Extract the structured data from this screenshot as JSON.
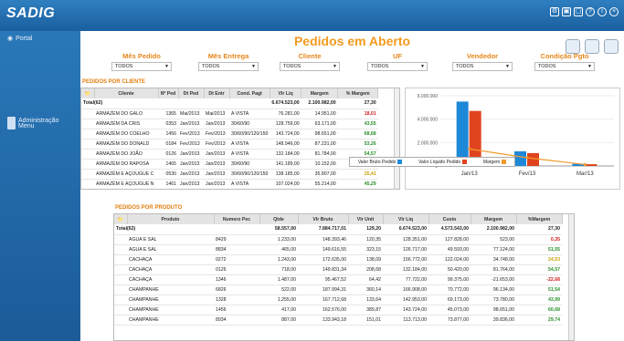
{
  "app": {
    "logo": "SADIG",
    "portal": "Portal"
  },
  "sidebar": [
    {
      "label": "Administração",
      "top": 92
    },
    {
      "label": "Menu",
      "top": 100
    }
  ],
  "page": {
    "title": "Pedidos em Aberto",
    "section1": "PEDIDOS POR CLIENTE",
    "section2": "PEDIDOS POR PRODUTO"
  },
  "filters": [
    {
      "label": "Mês Pedido",
      "value": "TODOS"
    },
    {
      "label": "Mês Entrega",
      "value": "TODOS"
    },
    {
      "label": "Cliente",
      "value": "TODOS"
    },
    {
      "label": "UF",
      "value": "TODOS"
    },
    {
      "label": "Vendedor",
      "value": "TODOS"
    },
    {
      "label": "Condição Pgto",
      "value": "TODOS"
    }
  ],
  "clients": {
    "headers": [
      "Cliente",
      "Nº Ped",
      "Dt Ped",
      "Dt Entr",
      "Cond. Pagt",
      "Vlr Liq",
      "Margem",
      "% Margem"
    ],
    "total": [
      "Total(62)",
      "",
      "",
      "",
      "",
      "6.674.523,00",
      "2.100.982,00",
      "27,30"
    ],
    "rows": [
      [
        "ARMAZÉM DO GALO",
        "1365",
        "Mai/2013",
        "Mai/2013",
        "A VISTA",
        "76.281,00",
        "14.951,00",
        "18,01",
        "neg"
      ],
      [
        "ARMAZÉM DA CRIS",
        "0353",
        "Jan/2013",
        "Jan/2013",
        "30/60/90",
        "128.759,00",
        "63.171,00",
        "43,55",
        "pos"
      ],
      [
        "ARMAZÉM DO COELHO",
        "1456",
        "Fev/2013",
        "Fev/2013",
        "30/60/90/120/150",
        "143.724,00",
        "98.651,00",
        "68,68",
        "pos"
      ],
      [
        "ARMAZÉM DO DONALD",
        "0184",
        "Fev/2013",
        "Fev/2013",
        "A VISTA",
        "148.946,00",
        "87.231,00",
        "53,26",
        "pos"
      ],
      [
        "ARMAZÉM DO JOÃO",
        "0126",
        "Jan/2013",
        "Jan/2013",
        "A VISTA",
        "132.184,00",
        "81.784,00",
        "54,57",
        "pos"
      ],
      [
        "ARMAZÉM DO RAPOSA",
        "1465",
        "Jan/2013",
        "Jan/2013",
        "30/60/90",
        "141.189,00",
        "10.152,00",
        "8,13",
        "neg"
      ],
      [
        "ARMAZÉM E AÇOUGUE C",
        "0530",
        "Jan/2013",
        "Jan/2013",
        "30/60/90/120/150",
        "138.185,00",
        "35.807,00",
        "25,41",
        "mid"
      ],
      [
        "ARMAZÉM E AÇOUGUE N",
        "1461",
        "Jan/2013",
        "Jan/2013",
        "A VISTA",
        "107.024,00",
        "55.214,00",
        "45,29",
        "pos"
      ]
    ]
  },
  "chart_data": {
    "type": "bar",
    "categories": [
      "Jan/13",
      "Fev/13",
      "Mar/13"
    ],
    "yticks": [
      "6.000.000",
      "4.000.000",
      "2.000.000",
      "0"
    ],
    "ylim": [
      0,
      6000000
    ],
    "series": [
      {
        "name": "Valor Bruto Pedido",
        "color": "#1e88d8",
        "values": [
          5500000,
          1250000,
          180000
        ]
      },
      {
        "name": "Valor Líquido Pedido",
        "color": "#e0441e",
        "values": [
          4700000,
          1100000,
          150000
        ]
      },
      {
        "name": "Margem",
        "color": "#f29a2e",
        "type": "line",
        "values": [
          1450000,
          700000,
          120000
        ]
      }
    ]
  },
  "products": {
    "headers": [
      "Produto",
      "Numero Pec",
      "Qtde",
      "Vlr Bruto",
      "Vlr Unit",
      "Vlr Liq",
      "Custo",
      "Margem",
      "%Margem"
    ],
    "total": [
      "Total(62)",
      "",
      "58.557,00",
      "7.884.717,01",
      "129,20",
      "6.674.523,00",
      "4.573.543,00",
      "2.100.982,00",
      "27,30"
    ],
    "rows": [
      [
        "AGUA E SAL",
        "8429",
        "1.233,00",
        "148.393,46",
        "120,35",
        "128.351,00",
        "127.828,00",
        "523,00",
        "0,35",
        "neg"
      ],
      [
        "AGUA E SAL",
        "8834",
        "465,00",
        "149.616,55",
        "323,15",
        "126.717,00",
        "49.593,00",
        "77.124,00",
        "51,55",
        "pos"
      ],
      [
        "CACHAÇA",
        "0272",
        "1.243,00",
        "172.635,00",
        "138,09",
        "156.772,00",
        "122.024,00",
        "34.748,00",
        "24,53",
        "mid"
      ],
      [
        "CACHAÇA",
        "0126",
        "718,00",
        "149.831,34",
        "208,68",
        "132.184,00",
        "50.420,00",
        "81.764,00",
        "54,57",
        "pos"
      ],
      [
        "CACHAÇA",
        "1346",
        "1.487,00",
        "95.467,52",
        "64,42",
        "77.722,00",
        "99.375,00",
        "-21.653,00",
        "-22,68",
        "neg"
      ],
      [
        "CHAMPANHE",
        "6826",
        "522,00",
        "187.994,31",
        "360,14",
        "166.908,00",
        "70.772,00",
        "96.134,00",
        "51,54",
        "pos"
      ],
      [
        "CHAMPANHE",
        "1328",
        "1.255,00",
        "167.712,68",
        "133,64",
        "142.953,00",
        "69.173,00",
        "73.780,00",
        "43,99",
        "pos"
      ],
      [
        "CHAMPANHE",
        "1456",
        "417,00",
        "162.576,00",
        "389,87",
        "143.724,00",
        "45.073,00",
        "98.651,00",
        "60,68",
        "pos"
      ],
      [
        "CHAMPANHE",
        "8934",
        "887,00",
        "133.943,18",
        "151,01",
        "113.713,00",
        "73.877,00",
        "39.836,00",
        "29,74",
        "pos"
      ]
    ]
  }
}
